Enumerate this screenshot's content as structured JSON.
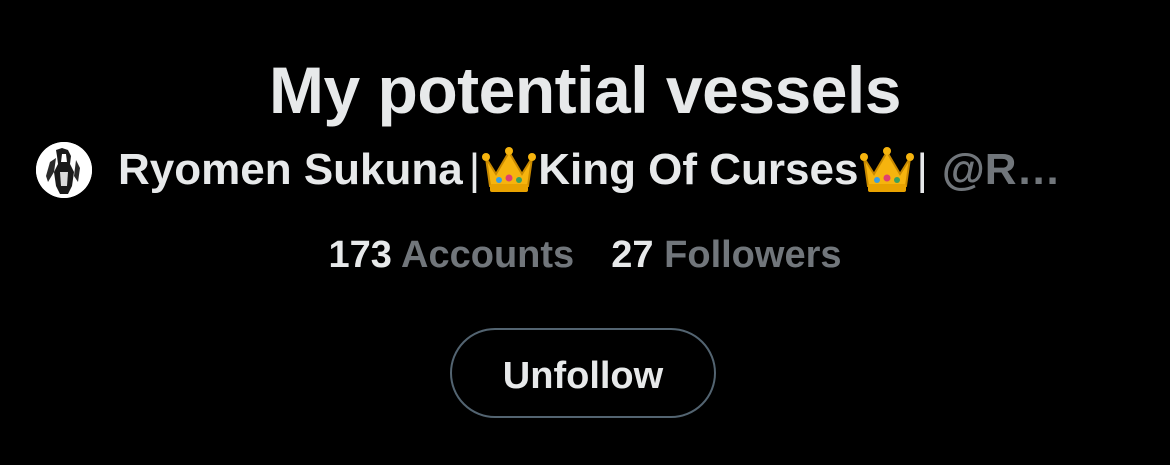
{
  "list": {
    "title": "My potential vessels",
    "owner": {
      "name_part1": "Ryomen Sukuna",
      "separator": "|",
      "name_part2": "King Of Curses",
      "handle": "@R…",
      "crown_icon": "crown-icon",
      "avatar_icon": "avatar"
    },
    "stats": {
      "accounts_count": "173",
      "accounts_label": "Accounts",
      "followers_count": "27",
      "followers_label": "Followers"
    },
    "unfollow_label": "Unfollow"
  },
  "colors": {
    "background": "#000000",
    "text_primary": "#e7e9ea",
    "text_secondary": "#71767b",
    "button_border": "#536471",
    "crown_gold": "#f4b400"
  }
}
